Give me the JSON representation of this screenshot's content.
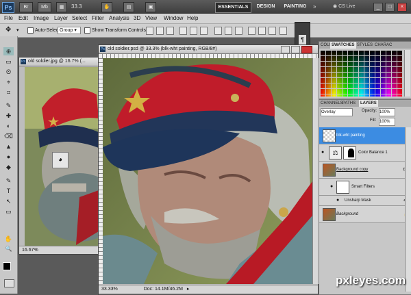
{
  "app": {
    "logo_text": "Ps",
    "toolbar_buttons": [
      "Br",
      "Mb"
    ],
    "zoom_value": "33.3",
    "workspaces": {
      "active": "ESSENTIALS",
      "design": "DESIGN",
      "painting": "PAINTING"
    },
    "cs_live": "CS Live",
    "window_buttons": [
      "_",
      "□",
      "×"
    ]
  },
  "menu": [
    "File",
    "Edit",
    "Image",
    "Layer",
    "Select",
    "Filter",
    "Analysis",
    "3D",
    "View",
    "Window",
    "Help"
  ],
  "options": {
    "auto_select_label": "Auto-Select:",
    "auto_select_value": "Group",
    "show_transform_label": "Show Transform Controls"
  },
  "tools": [
    "⊕",
    "▭",
    "ʘ",
    "⌖",
    "⌗",
    "✎",
    "✚",
    "◐",
    "⌫",
    "▲",
    "●",
    "◆",
    "✎",
    "T",
    "↖",
    "▭",
    "✋",
    "🔍"
  ],
  "doc_back": {
    "title": "old soldier.jpg @ 16.7% (...",
    "zoom": "16.67%"
  },
  "doc_front": {
    "title": "old soldier.psd @ 33.3% (blk-wht painting, RGB/8#)",
    "zoom": "33.33%",
    "doc_info": "Doc: 14.1M/46.2M"
  },
  "floating_icon": "¶",
  "swatches_panel": {
    "tabs": [
      "COLOR",
      "SWATCHES",
      "STYLES",
      "CHARAC"
    ],
    "active_tab": "SWATCHES"
  },
  "layers_panel": {
    "tabs": [
      "CHANNELS",
      "PATHS",
      "LAYERS"
    ],
    "blend_mode": "Overlay",
    "opacity_label": "Opacity:",
    "opacity_value": "100%",
    "fill_label": "Fill:",
    "fill_value": "100%",
    "layers": [
      {
        "name": "blk-wht painting",
        "selected": true
      },
      {
        "name": "Color Balance 1",
        "selected": false
      },
      {
        "name": "Background copy",
        "selected": false
      },
      {
        "name": "Smart Filters",
        "selected": false
      },
      {
        "name": "Unsharp Mask",
        "selected": false
      },
      {
        "name": "Background",
        "selected": false
      }
    ]
  },
  "watermark": "pxleyes.com"
}
